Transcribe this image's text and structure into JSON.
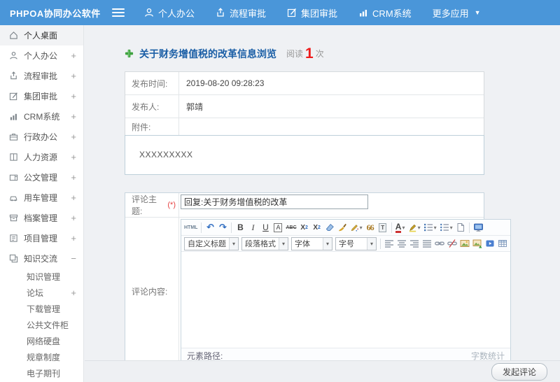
{
  "header": {
    "logo": "PHPOA协同办公软件",
    "nav": [
      {
        "label": "个人办公"
      },
      {
        "label": "流程审批"
      },
      {
        "label": "集团审批"
      },
      {
        "label": "CRM系统"
      },
      {
        "label": "更多应用"
      }
    ]
  },
  "sidebar": {
    "items": [
      {
        "label": "个人桌面",
        "toggle": ""
      },
      {
        "label": "个人办公",
        "toggle": "+"
      },
      {
        "label": "流程审批",
        "toggle": "+"
      },
      {
        "label": "集团审批",
        "toggle": "+"
      },
      {
        "label": "CRM系统",
        "toggle": "+"
      },
      {
        "label": "行政办公",
        "toggle": "+"
      },
      {
        "label": "人力资源",
        "toggle": "+"
      },
      {
        "label": "公文管理",
        "toggle": "+"
      },
      {
        "label": "用车管理",
        "toggle": "+"
      },
      {
        "label": "档案管理",
        "toggle": "+"
      },
      {
        "label": "项目管理",
        "toggle": "+"
      },
      {
        "label": "知识交流",
        "toggle": "−"
      }
    ],
    "subitems": [
      {
        "label": "知识管理",
        "toggle": ""
      },
      {
        "label": "论坛",
        "toggle": "+"
      },
      {
        "label": "下载管理",
        "toggle": ""
      },
      {
        "label": "公共文件柜",
        "toggle": ""
      },
      {
        "label": "网络硬盘",
        "toggle": ""
      },
      {
        "label": "规章制度",
        "toggle": ""
      },
      {
        "label": "电子期刊",
        "toggle": ""
      }
    ]
  },
  "article": {
    "title": "关于财务增值税的改革信息浏览",
    "read_label": "阅读",
    "read_count": "1",
    "read_unit": "次",
    "fields": [
      {
        "label": "发布时间:",
        "value": "2019-08-20 09:28:23"
      },
      {
        "label": "发布人:",
        "value": "郭靖"
      },
      {
        "label": "附件:",
        "value": ""
      }
    ],
    "content": "XXXXXXXXX"
  },
  "comment": {
    "subject_label": "评论主题:",
    "required_mark": "(*)",
    "subject_value": "回复:关于财务增值税的改革",
    "content_label": "评论内容:",
    "submit_label": "发起评论"
  },
  "editor": {
    "html_button": "HTML",
    "bold": "B",
    "italic": "I",
    "underline": "U",
    "boxed_a": "A",
    "strike": "ABC",
    "sup_base": "X",
    "sup_n": "2",
    "sub_base": "X",
    "sub_n": "2",
    "quote": "66",
    "paste_t": "T",
    "font_color_a": "A",
    "dropdowns": [
      {
        "label": "自定义标题"
      },
      {
        "label": "段落格式"
      },
      {
        "label": "字体"
      },
      {
        "label": "字号"
      }
    ],
    "footer_left": "元素路径:",
    "footer_right": "字数统计"
  },
  "colors": {
    "header_bg": "#4a96d9",
    "title_text": "#1b5fa6",
    "read_count": "#ee1a1a",
    "plus_icon": "#3fa23f",
    "required_mark": "#e64040"
  }
}
